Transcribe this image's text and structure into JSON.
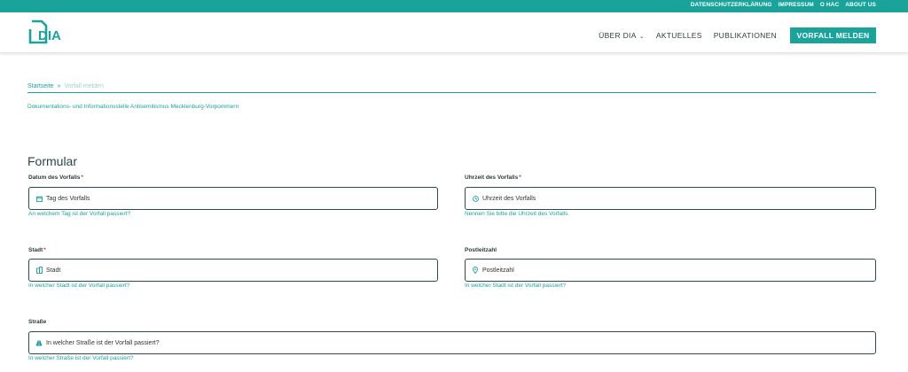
{
  "topbar": {
    "links": [
      "DATENSCHUTZERKLÄRUNG",
      "IMPRESSUM",
      "O HAC",
      "ABOUT US"
    ]
  },
  "header": {
    "logo_text": "DIA",
    "nav": {
      "about": "ÜBER DIA",
      "news": "AKTUELLES",
      "publications": "PUBLIKATIONEN",
      "cta": "VORFALL MELDEN"
    }
  },
  "breadcrumb": {
    "home": "Startseite",
    "separator": "»",
    "current": "Vorfall melden"
  },
  "organization": "Dokumentations- und Informationsstelle Antisemitismus Mecklenburg-Vorpommern",
  "form": {
    "title": "Formular",
    "date": {
      "label": "Datum des Vorfalls",
      "required": "*",
      "placeholder": "Tag des Vorfalls",
      "hint": "An welchem Tag ist der Vorfall passiert?",
      "icon": "calendar-icon"
    },
    "time": {
      "label": "Uhrzeit des Vorfalls",
      "required": "*",
      "placeholder": "Uhrzeit des Vorfalls",
      "hint": "Nennen Sie bitte die Uhrzeit des Vorfalls.",
      "icon": "clock-icon"
    },
    "city": {
      "label": "Stadt",
      "required": "*",
      "placeholder": "Stadt",
      "hint": "In welcher Stadt ist der Vorfall passiert?",
      "icon": "building-icon"
    },
    "zip": {
      "label": "Postleitzahl",
      "placeholder": "Postleitzahl",
      "hint": "In welcher Stadt ist der Vorfall passiert?",
      "icon": "map-pin-icon"
    },
    "street": {
      "label": "Straße",
      "placeholder": "In welcher Straße ist der Vorfall passiert?",
      "hint": "In welcher Straße ist der Vorfall passiert?",
      "icon": "road-icon"
    }
  },
  "colors": {
    "accent": "#1aa39a",
    "border": "#2c4a4a",
    "required": "#dd3333"
  }
}
